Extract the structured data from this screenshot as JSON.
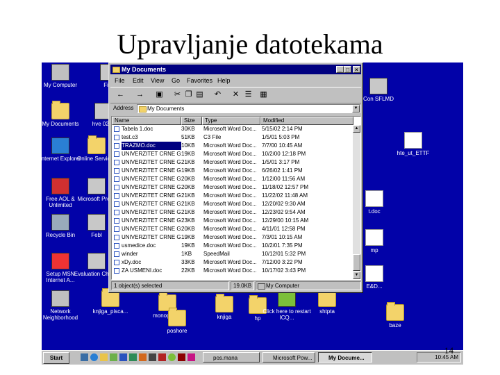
{
  "slide": {
    "title": "Upravljanje datotekama",
    "page_number": "14"
  },
  "desktop_icons": [
    {
      "label": "My Computer",
      "icon": "computer-icon"
    },
    {
      "label": "Fing",
      "icon": "program-icon"
    },
    {
      "label": "My Documents",
      "icon": "folder-icon"
    },
    {
      "label": "hve 027s",
      "icon": "program-icon"
    },
    {
      "label": "Internet Explorer",
      "icon": "ie-icon"
    },
    {
      "label": "Online Services",
      "icon": "folder-icon"
    },
    {
      "label": "Free AOL & Unlimited",
      "icon": "aol-icon"
    },
    {
      "label": "Microsoft Press",
      "icon": "program-icon"
    },
    {
      "label": "Recycle Bin",
      "icon": "recycle-bin-icon"
    },
    {
      "label": "Febl",
      "icon": "program-icon"
    },
    {
      "label": "Setup MSN Internet A...",
      "icon": "msn-icon"
    },
    {
      "label": "Evaluation Choice",
      "icon": "program-icon"
    },
    {
      "label": "Network Neighborhood",
      "icon": "network-icon"
    },
    {
      "label": "knjiga_pisca...",
      "icon": "folder-icon"
    },
    {
      "label": "monografija",
      "icon": "folder-icon"
    },
    {
      "label": "knjiga",
      "icon": "folder-icon"
    },
    {
      "label": "hp",
      "icon": "folder-icon"
    },
    {
      "label": "Click here to restart ICQ...",
      "icon": "icq-icon"
    },
    {
      "label": "shtpta",
      "icon": "folder-icon"
    },
    {
      "label": "baze",
      "icon": "folder-icon"
    },
    {
      "label": "poshore",
      "icon": "folder-icon"
    },
    {
      "label": "Con SFLMD",
      "icon": "program-icon"
    },
    {
      "label": "hte_ut_ETTF",
      "icon": "document-icon"
    },
    {
      "label": "t.doc",
      "icon": "document-icon"
    },
    {
      "label": "mp",
      "icon": "document-icon"
    },
    {
      "label": "E&D...",
      "icon": "document-icon"
    }
  ],
  "window": {
    "title": "My Documents",
    "menu": [
      "File",
      "Edit",
      "View",
      "Go",
      "Favorites",
      "Help"
    ],
    "address_label": "Address",
    "address_value": "My Documents",
    "columns": [
      "Name",
      "Size",
      "Type",
      "Modified"
    ],
    "files": [
      {
        "name": "Tabela 1.doc",
        "size": "30KB",
        "type": "Microsoft Word Doc...",
        "modified": "5/15/02 2:14 PM"
      },
      {
        "name": "test.c3",
        "size": "51KB",
        "type": "C3 File",
        "modified": "1/5/01 5:03 PM"
      },
      {
        "name": "TRAZMO.doc",
        "size": "10KB",
        "type": "Microsoft Word Doc...",
        "modified": "7/7/00 10:45 AM"
      },
      {
        "name": "UNIVERZITET CRNE G...",
        "size": "19KB",
        "type": "Microsoft Word Doc...",
        "modified": "10/2/00 12:18 PM"
      },
      {
        "name": "UNIVERZITET CRNE G...",
        "size": "21KB",
        "type": "Microsoft Word Doc...",
        "modified": "1/5/01 3:17 PM"
      },
      {
        "name": "UNIVERZITET CRNE G...",
        "size": "19KB",
        "type": "Microsoft Word Doc...",
        "modified": "6/26/02 1:41 PM"
      },
      {
        "name": "UNIVERZITET CRNE G...",
        "size": "20KB",
        "type": "Microsoft Word Doc...",
        "modified": "1/12/00 11:56 AM"
      },
      {
        "name": "UNIVERZITET CRNE G...",
        "size": "20KB",
        "type": "Microsoft Word Doc...",
        "modified": "11/18/02 12:57 PM"
      },
      {
        "name": "UNIVERZITET CRNE G...",
        "size": "21KB",
        "type": "Microsoft Word Doc...",
        "modified": "11/22/02 11:48 AM"
      },
      {
        "name": "UNIVERZITET CRNE G...",
        "size": "21KB",
        "type": "Microsoft Word Doc...",
        "modified": "12/20/02 9:30 AM"
      },
      {
        "name": "UNIVERZITET CRNE G...",
        "size": "21KB",
        "type": "Microsoft Word Doc...",
        "modified": "12/23/02 9:54 AM"
      },
      {
        "name": "UNIVERZITET CRNE G...",
        "size": "23KB",
        "type": "Microsoft Word Doc...",
        "modified": "12/29/00 10:15 AM"
      },
      {
        "name": "UNIVERZITET CRNE G...",
        "size": "20KB",
        "type": "Microsoft Word Doc...",
        "modified": "4/11/01 12:58 PM"
      },
      {
        "name": "UNIVERZITET CRNE G...",
        "size": "19KB",
        "type": "Microsoft Word Doc...",
        "modified": "7/3/01 10:15 AM"
      },
      {
        "name": "usmedice.doc",
        "size": "19KB",
        "type": "Microsoft Word Doc...",
        "modified": "10/2/01 7:35 PM"
      },
      {
        "name": "winder",
        "size": "1KB",
        "type": "SpeedMail",
        "modified": "10/12/01 5:32 PM"
      },
      {
        "name": "xDy.doc",
        "size": "33KB",
        "type": "Microsoft Word Doc...",
        "modified": "7/12/00 3:22 PM"
      },
      {
        "name": "ZA USMENI.doc",
        "size": "22KB",
        "type": "Microsoft Word Doc...",
        "modified": "10/17/02 3:43 PM"
      }
    ],
    "selected_index": 2,
    "status": {
      "selected": "1 object(s) selected",
      "size": "19.0KB",
      "location": "My Computer"
    }
  },
  "taskbar": {
    "start_label": "Start",
    "tasks": [
      {
        "label": "pos.mana",
        "active": false
      },
      {
        "label": "Microsoft Pow...",
        "active": false
      },
      {
        "label": "My Docume...",
        "active": true
      }
    ],
    "clock": "10:45 AM"
  },
  "colors": {
    "desktop": "#0202a8",
    "titlebar": "#000080",
    "selection": "#000080",
    "chrome": "#c0c0c0"
  }
}
